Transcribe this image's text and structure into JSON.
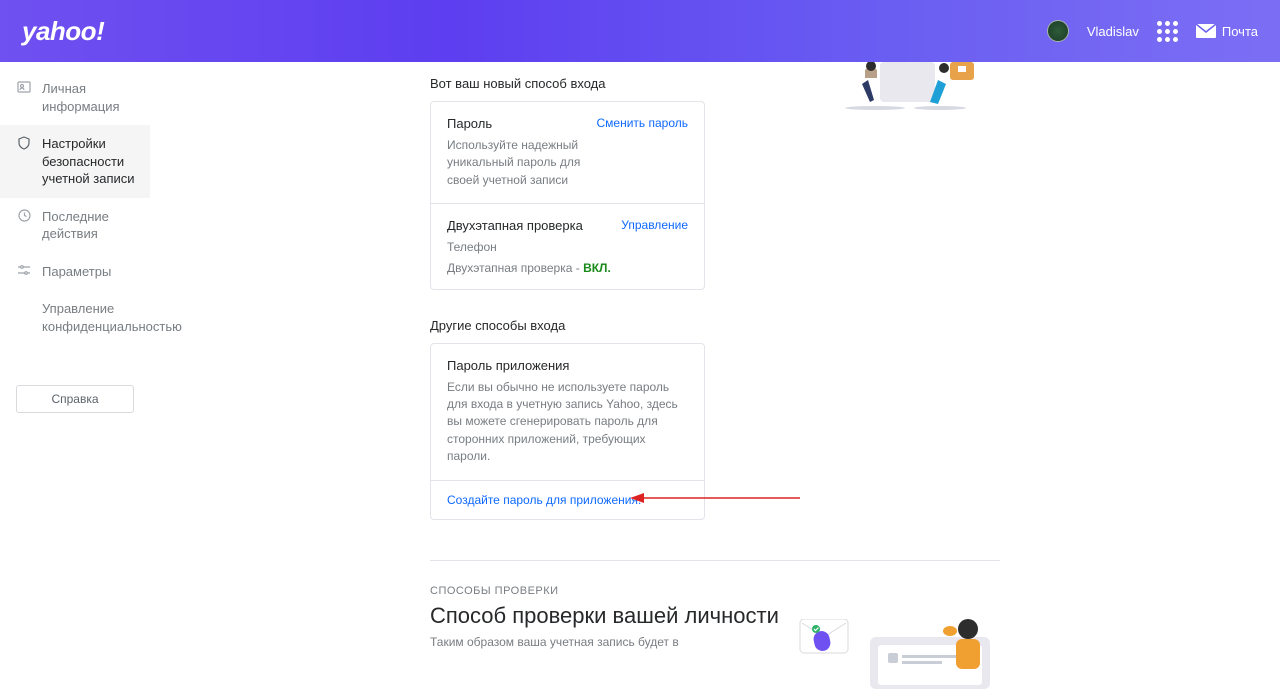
{
  "header": {
    "logo": "yahoo!",
    "username": "Vladislav",
    "mail_label": "Почта"
  },
  "sidebar": {
    "personal": "Личная информация",
    "security": "Настройки безопасности учетной записи",
    "recent": "Последние действия",
    "params": "Параметры",
    "privacy": "Управление конфиденциальностью",
    "help": "Справка"
  },
  "main": {
    "new_method_title": "Вот ваш новый способ входа",
    "password": {
      "title": "Пароль",
      "desc": "Используйте надежный уникальный пароль для своей учетной записи",
      "change_link": "Сменить пароль"
    },
    "two_step": {
      "title": "Двухэтапная проверка",
      "phone": "Телефон",
      "status_prefix": "Двухэтапная проверка - ",
      "status_on": "ВКЛ.",
      "manage_link": "Управление"
    },
    "other_title": "Другие способы входа",
    "app_pw": {
      "title": "Пароль приложения",
      "desc": "Если вы обычно не используете пароль для входа в учетную запись Yahoo, здесь вы можете сгенерировать пароль для сторонних приложений, требующих пароли.",
      "create_link": "Создайте пароль для приложения."
    },
    "verify": {
      "small": "СПОСОБЫ ПРОВЕРКИ",
      "heading": "Способ проверки вашей личности",
      "sub": "Таким образом ваша учетная запись будет в"
    }
  }
}
